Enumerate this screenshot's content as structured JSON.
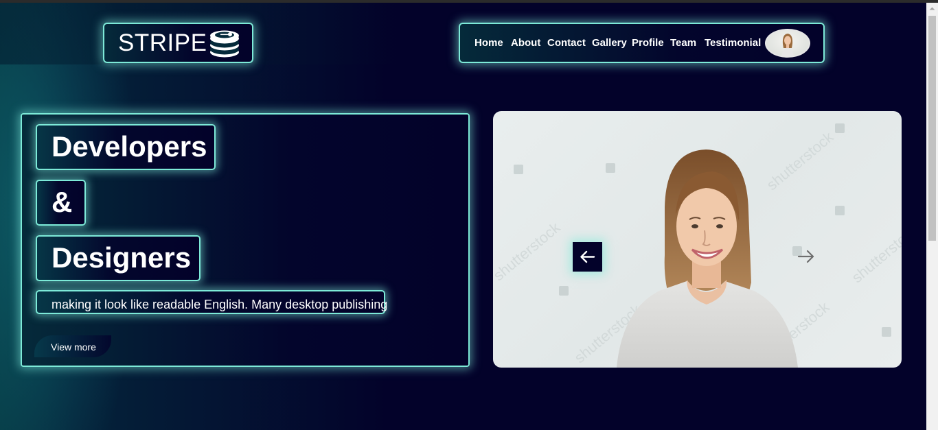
{
  "logo": {
    "text": "STRIPE",
    "icon": "database-icon"
  },
  "nav": {
    "items": [
      "Home",
      "About",
      "Contact",
      "Gallery",
      "Profile",
      "Team",
      "Testimonial"
    ],
    "avatar": "profile-avatar"
  },
  "hero": {
    "line1": "Developers",
    "line2": "&",
    "line3": "Designers",
    "description": "making it look like readable English. Many desktop publishing",
    "button": "View more"
  },
  "slider": {
    "image": "smiling-woman-photo",
    "watermark": "shutterstock",
    "prev_icon": "arrow-left-icon",
    "next_icon": "arrow-right-icon"
  },
  "colors": {
    "background": "#03022a",
    "glow": "#7dead8",
    "accent": "#06394a"
  }
}
